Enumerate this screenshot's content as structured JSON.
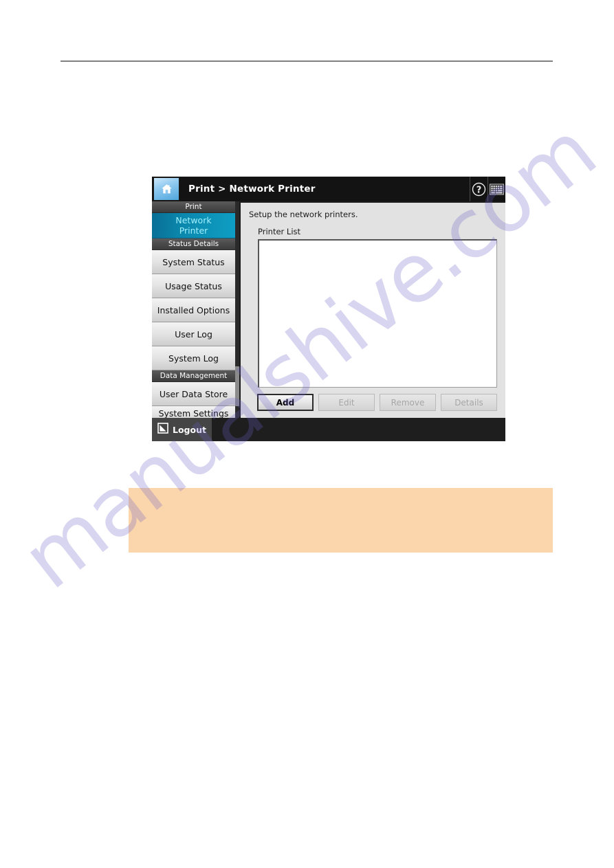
{
  "page": {
    "watermark_text": "manualshive.com",
    "accent_selected": "#0f9ec4",
    "note_box_color": "#fbd5ab",
    "panel_bg": "#1c1c1c"
  },
  "device": {
    "title_bar": {
      "home_icon": "home-icon",
      "breadcrumb": "Print > Network Printer",
      "help_icon": "help-circle-icon",
      "keyboard_icon": "keyboard-icon"
    },
    "sidebar": {
      "groups": [
        {
          "header": "Print",
          "items": [
            {
              "label": "Network Printer",
              "line1": "Network",
              "line2": "Printer",
              "selected": true
            }
          ]
        },
        {
          "header": "Status Details",
          "items": [
            {
              "label": "System Status",
              "selected": false
            },
            {
              "label": "Usage Status",
              "selected": false
            },
            {
              "label": "Installed Options",
              "selected": false
            },
            {
              "label": "User Log",
              "selected": false
            },
            {
              "label": "System Log",
              "selected": false
            }
          ]
        },
        {
          "header": "Data Management",
          "items": [
            {
              "label": "User Data Store",
              "selected": false
            },
            {
              "label": "System Settings",
              "selected": false,
              "clipped": true
            }
          ]
        }
      ],
      "scrollbar": "sidebar-scrollbar"
    },
    "content": {
      "description": "Setup the network printers.",
      "list_label": "Printer List",
      "printer_list_items": [],
      "buttons": [
        {
          "label": "Add",
          "enabled": true
        },
        {
          "label": "Edit",
          "enabled": false
        },
        {
          "label": "Remove",
          "enabled": false
        },
        {
          "label": "Details",
          "enabled": false
        }
      ]
    },
    "footer": {
      "logout_label": "Logout",
      "logout_icon": "logout-icon"
    }
  }
}
